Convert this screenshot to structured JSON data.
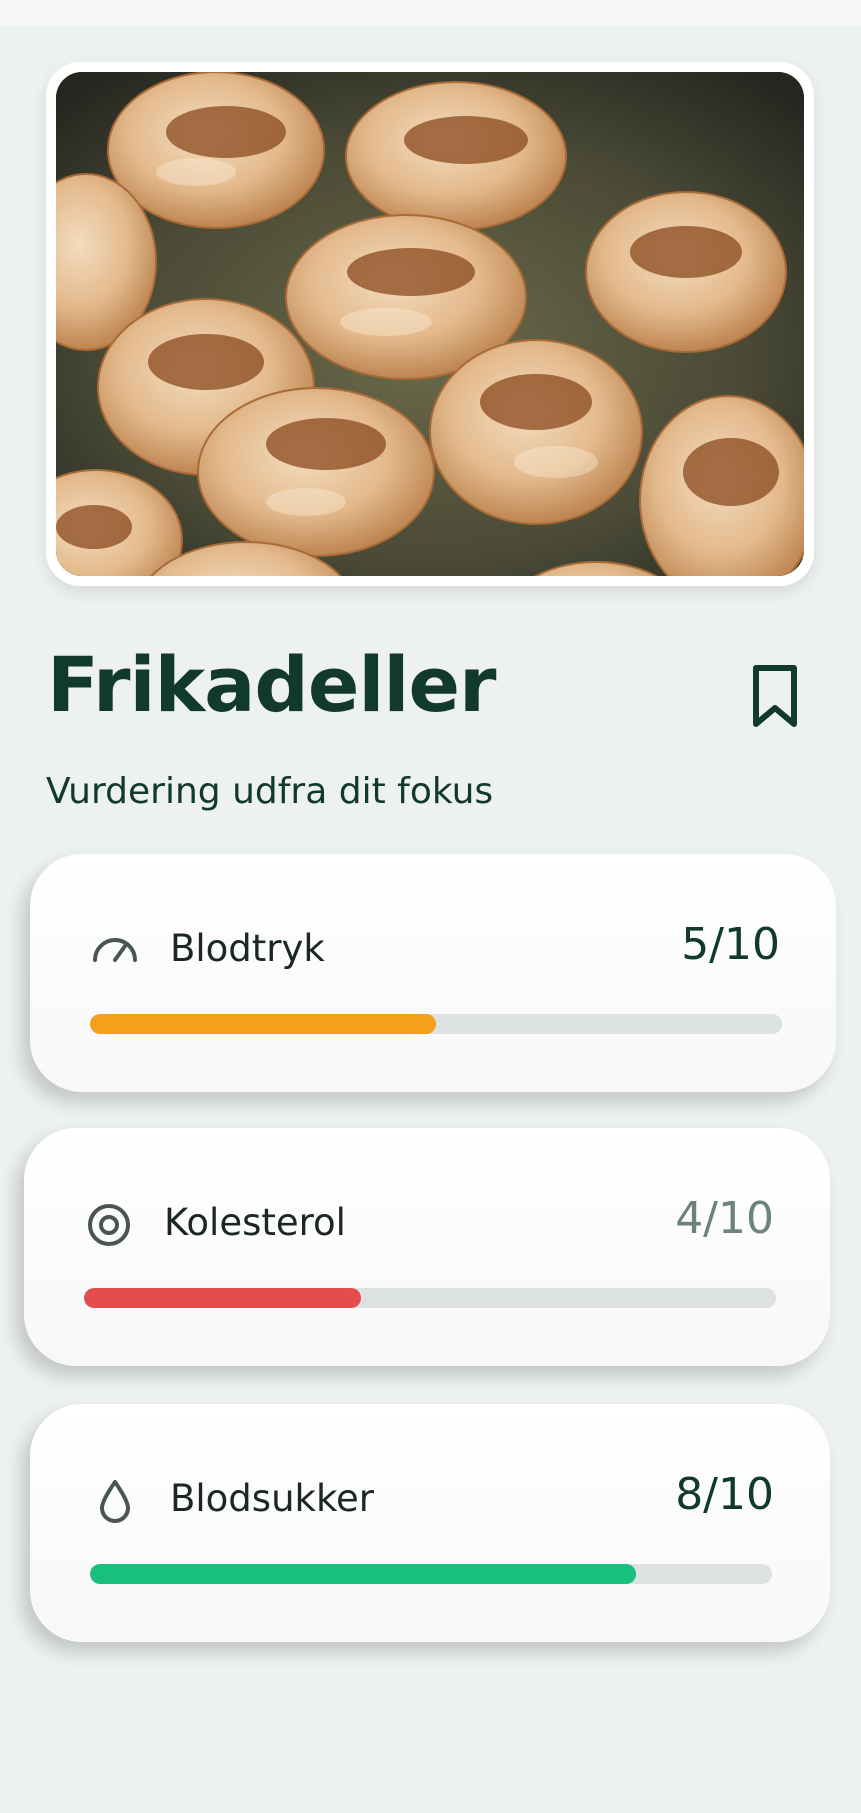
{
  "recipe": {
    "title": "Frikadeller",
    "subtitle": "Vurdering udfra dit fokus",
    "image_icon": "food-photo-frikadeller",
    "bookmark_icon": "bookmark-icon"
  },
  "ratings": [
    {
      "label": "Blodtryk",
      "score": "5/10",
      "value": 0.5,
      "color": "#f5a019",
      "icon": "gauge-icon"
    },
    {
      "label": "Kolesterol",
      "score": "4/10",
      "value": 0.4,
      "color": "#e34d4e",
      "icon": "target-icon"
    },
    {
      "label": "Blodsukker",
      "score": "8/10",
      "value": 0.8,
      "color": "#18bf7f",
      "icon": "droplet-icon"
    }
  ]
}
